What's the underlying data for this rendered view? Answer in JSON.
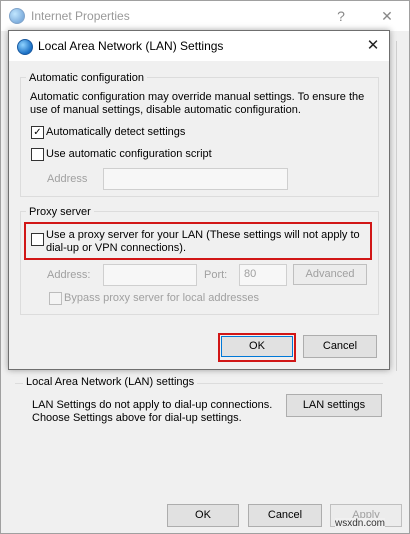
{
  "outer_window": {
    "title": "Internet Properties",
    "help_glyph": "?",
    "close_glyph": "✕",
    "lan_section": {
      "heading": "Local Area Network (LAN) settings",
      "description_line1": "LAN Settings do not apply to dial-up connections.",
      "description_line2": "Choose Settings above for dial-up settings.",
      "lan_settings_label": "LAN settings"
    },
    "footer": {
      "ok_label": "OK",
      "cancel_label": "Cancel",
      "apply_label": "Apply"
    }
  },
  "dialog": {
    "title": "Local Area Network (LAN) Settings",
    "close_glyph": "✕",
    "auto_config": {
      "legend": "Automatic configuration",
      "description_line1": "Automatic configuration may override manual settings.  To ensure the",
      "description_line2": "use of manual settings, disable automatic configuration.",
      "auto_detect_label": "Automatically detect settings",
      "auto_detect_checked": true,
      "auto_script_label": "Use automatic configuration script",
      "auto_script_checked": false,
      "address_label": "Address",
      "address_value": ""
    },
    "proxy": {
      "legend": "Proxy server",
      "use_proxy_label_line1": "Use a proxy server for your LAN (These settings will not apply to",
      "use_proxy_label_line2": "dial-up or VPN connections).",
      "use_proxy_checked": false,
      "address_label": "Address:",
      "address_value": "",
      "port_label": "Port:",
      "port_value": "80",
      "advanced_label": "Advanced",
      "bypass_label": "Bypass proxy server for local addresses",
      "bypass_checked": false
    },
    "ok_label": "OK",
    "cancel_label": "Cancel"
  },
  "watermark": "wsxdn.com",
  "colors": {
    "highlight_red": "#d11616",
    "accent_blue": "#0078d7"
  },
  "icons": {
    "window_icon": "internet-options-globe-icon",
    "check": "checkmark-icon"
  }
}
